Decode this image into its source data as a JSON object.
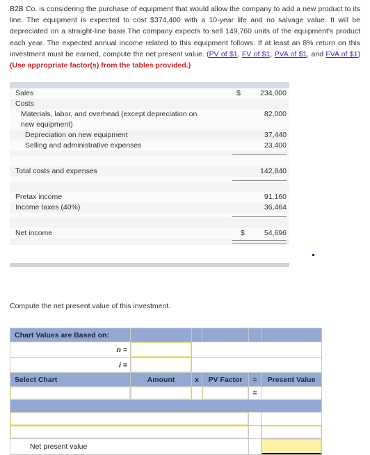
{
  "problem": {
    "text_1": "B2B Co. is considering the purchase of equipment that would allow the company to add a new product to its line. The equipment is expected to cost $374,400 with a 10-year life and no salvage value. It will be depreciated on a straight-line basis.The company expects to sell 149,760 units of the equipment's product each year. The expected annual income related to this equipment follows. If at least an 8% return on this investment must be earned, compute the net present value. (",
    "link_pv": "PV of $1",
    "sep_1": ", ",
    "link_fv": "FV of $1",
    "sep_2": ", ",
    "link_pva": "PVA of $1",
    "sep_3": ", and ",
    "link_fva": "FVA of $1",
    "close_paren": ") ",
    "instruction_bold": "(Use appropriate factor(s) from the tables provided.)"
  },
  "income_statement": {
    "rows": [
      {
        "label": "Sales",
        "currency": "$",
        "amount": "234,000"
      },
      {
        "label": "Costs",
        "currency": "",
        "amount": ""
      },
      {
        "label": "Materials, labor, and overhead (except depreciation on new equipment)",
        "currency": "",
        "amount": "82,000"
      },
      {
        "label": "Depreciation on new equipment",
        "currency": "",
        "amount": "37,440"
      },
      {
        "label": "Selling and administrative expenses",
        "currency": "",
        "amount": "23,400"
      },
      {
        "label": "Total costs and expenses",
        "currency": "",
        "amount": "142,840"
      },
      {
        "label": "Pretax income",
        "currency": "",
        "amount": "91,160"
      },
      {
        "label": "Income taxes (40%)",
        "currency": "",
        "amount": "36,464"
      },
      {
        "label": "Net income",
        "currency": "$",
        "amount": "54,696"
      }
    ]
  },
  "compute_prompt": "Compute the net present value of this investment.",
  "npv_worksheet": {
    "chart_values_header": "Chart Values are Based on:",
    "n_label": "n =",
    "i_label": "i =",
    "n_value": "",
    "i_value": "",
    "columns": {
      "select_chart": "Select Chart",
      "amount": "Amount",
      "times": "x",
      "pv_factor": "PV Factor",
      "equals": "=",
      "present_value": "Present Value"
    },
    "entry_row": {
      "select_chart": "",
      "amount": "",
      "times": "",
      "pv_factor": "",
      "equals_sign": "=",
      "present_value": ""
    },
    "extra_rows": [
      {
        "description": "",
        "present_value": ""
      },
      {
        "description": "",
        "present_value": ""
      }
    ],
    "net_present_value_label": "Net present value",
    "net_present_value": ""
  },
  "colors": {
    "header_blue": "#93a9d4",
    "input_yellow_border": "#e8e08a",
    "answer_yellow": "#fbf2a8",
    "band_gray": "#ced3de",
    "link_blue": "#2b2bbb",
    "instruction_red": "#cc2222"
  }
}
